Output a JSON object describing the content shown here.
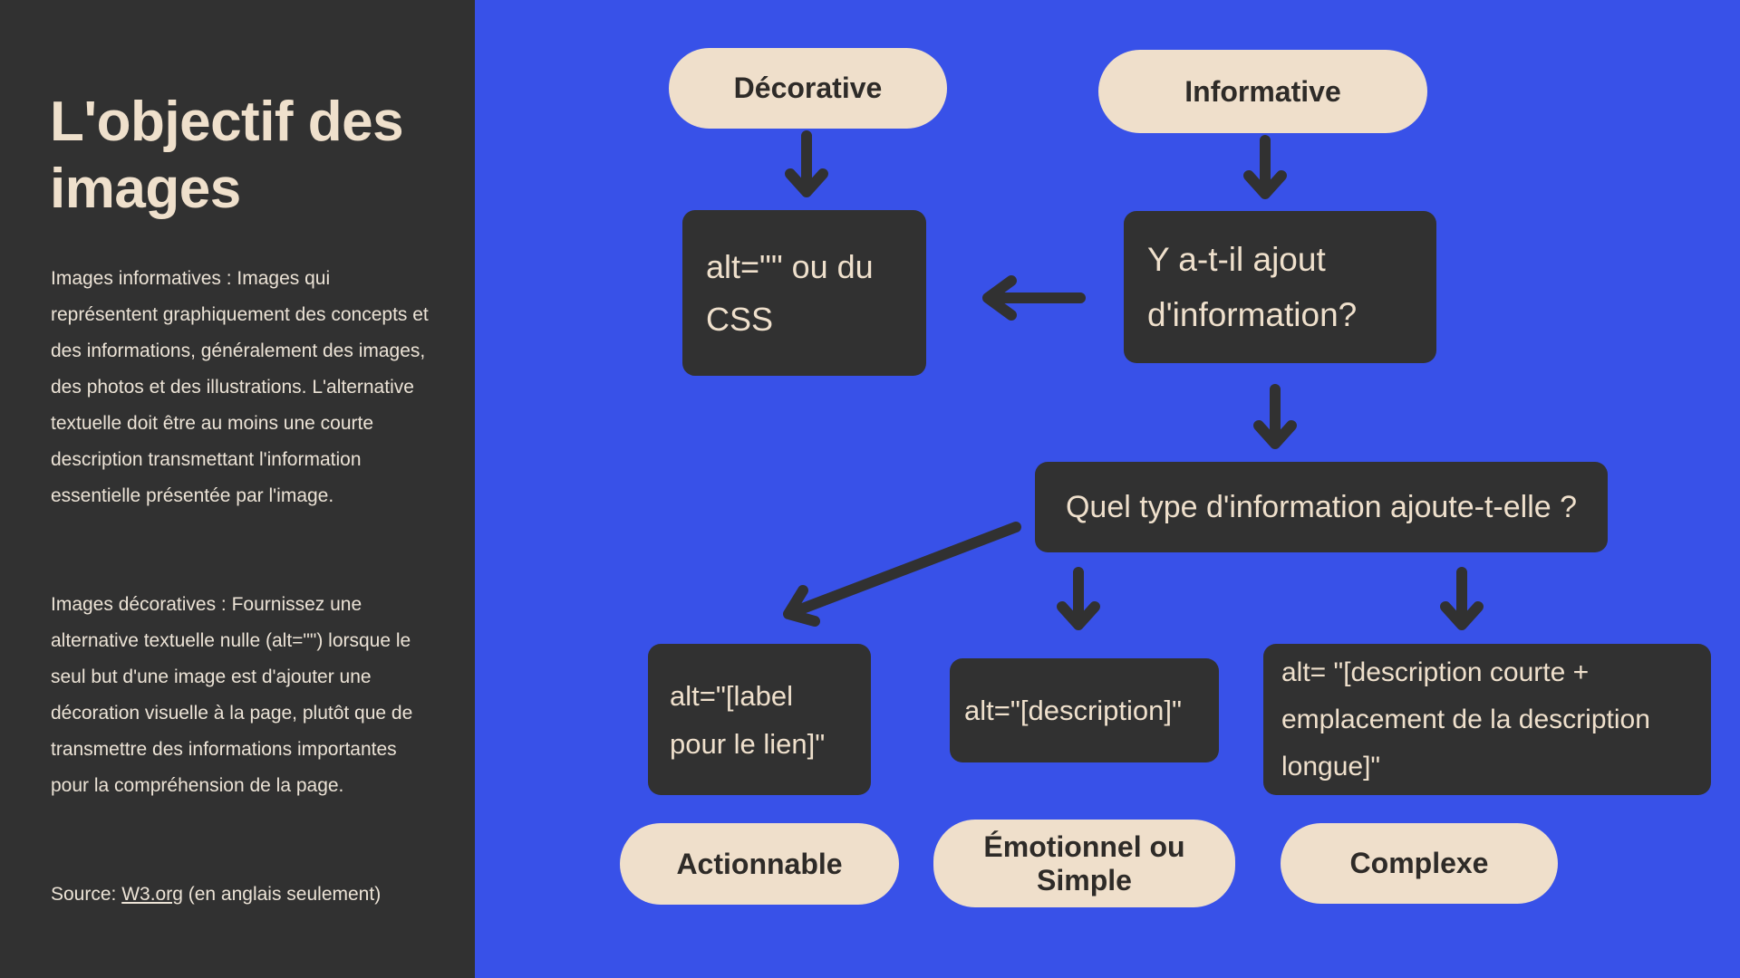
{
  "sidebar": {
    "title": "L'objectif des images",
    "paragraph_informative": "Images informatives : Images qui représentent graphiquement des concepts et des informations, généralement des images, des photos et des illustrations. L'alternative textuelle doit être au moins une courte description transmettant l'information essentielle présentée par l'image.",
    "paragraph_decorative": "Images décoratives : Fournissez une alternative textuelle nulle (alt=\"\") lorsque le seul but d'une image est d'ajouter une décoration visuelle à la page, plutôt que de transmettre des informations importantes pour la compréhension de la page.",
    "source_prefix": "Source: ",
    "source_link": "W3.org",
    "source_suffix": " (en anglais seulement)"
  },
  "diagram": {
    "nodes": {
      "decorative": "Décorative",
      "informative": "Informative",
      "alt_empty": "alt=\"\" ou du CSS",
      "question_added_info": "Y a-t-il ajout d'information?",
      "question_info_type": "Quel type d'information ajoute-t-elle ?",
      "alt_label": "alt=\"[label pour le lien]\"",
      "alt_description": "alt=\"[description]\"",
      "alt_complex": "alt= \"[description courte + emplacement de la description longue]\"",
      "actionable": "Actionnable",
      "emotional_simple": "Émotionnel ou Simple",
      "complex": "Complexe"
    },
    "edges": [
      {
        "from": "decorative",
        "to": "alt_empty"
      },
      {
        "from": "informative",
        "to": "question_added_info"
      },
      {
        "from": "question_added_info",
        "to": "alt_empty"
      },
      {
        "from": "question_added_info",
        "to": "question_info_type"
      },
      {
        "from": "question_info_type",
        "to": "alt_label"
      },
      {
        "from": "question_info_type",
        "to": "alt_description"
      },
      {
        "from": "question_info_type",
        "to": "alt_complex"
      }
    ]
  },
  "colors": {
    "background": "#3851e8",
    "sidebar": "#313131",
    "box": "#313131",
    "pill": "#efdfcb",
    "text_light": "#efe0cc",
    "text_dark": "#2e2b28"
  }
}
